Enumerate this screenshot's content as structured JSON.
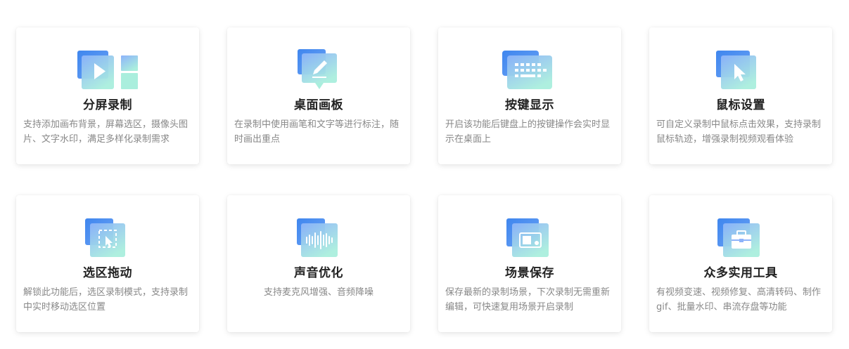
{
  "features": [
    {
      "title": "分屏录制",
      "desc": "支持添加画布背景，屏幕选区，摄像头图片、文字水印，满足多样化录制需求",
      "icon": "split-screen-icon"
    },
    {
      "title": "桌面画板",
      "desc": "在录制中使用画笔和文字等进行标注，随时画出重点",
      "icon": "pen-board-icon"
    },
    {
      "title": "按键显示",
      "desc": "开启该功能后键盘上的按键操作会实时显示在桌面上",
      "icon": "keyboard-icon"
    },
    {
      "title": "鼠标设置",
      "desc": "可自定义录制中鼠标点击效果，支持录制鼠标轨迹，增强录制视频观看体验",
      "icon": "mouse-cursor-icon"
    },
    {
      "title": "选区拖动",
      "desc": "解锁此功能后，选区录制模式，支持录制中实时移动选区位置",
      "icon": "selection-drag-icon"
    },
    {
      "title": "声音优化",
      "desc": "支持麦克风增强、音频降噪",
      "icon": "sound-wave-icon"
    },
    {
      "title": "场景保存",
      "desc": "保存最新的录制场景，下次录制无需重新编辑，可快速复用场景开启录制",
      "icon": "scene-save-icon"
    },
    {
      "title": "众多实用工具",
      "desc": "有视频变速、视频修复、高清转码、制作gif、批量水印、串流存盘等功能",
      "icon": "toolbox-icon"
    }
  ],
  "colors": {
    "icon_blue": "#4a8cf0",
    "icon_light_blue": "#8fb8fa",
    "icon_mint": "#a8ecd8",
    "title": "#222222",
    "desc": "#888888"
  }
}
